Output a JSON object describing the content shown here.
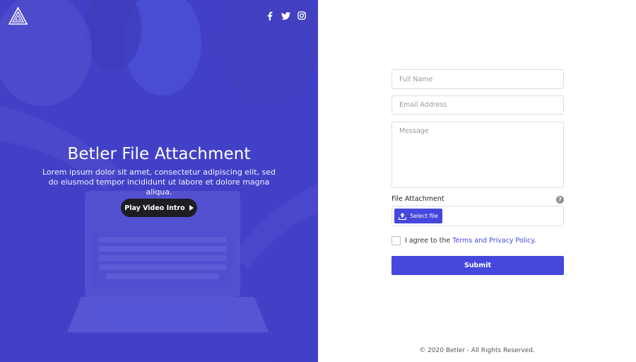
{
  "hero": {
    "title": "Betler File Attachment",
    "description": "Lorem ipsum dolor sit amet, consectetur adipiscing elit, sed do eiusmod tempor incididunt ut labore et dolore magna aliqua.",
    "video_button_label": "Play Video Intro",
    "social": [
      "facebook-icon",
      "twitter-icon",
      "instagram-icon"
    ]
  },
  "form": {
    "full_name_placeholder": "Full Name",
    "email_placeholder": "Email Address",
    "message_placeholder": "Message",
    "file_attachment_label": "File Attachment",
    "help_glyph": "?",
    "select_file_label": "Select file",
    "agree_prefix": "I agree to the ",
    "agree_link": "Terms and Privacy Policy",
    "agree_suffix": ".",
    "submit_label": "Submit"
  },
  "footer": {
    "copyright": "© 2020 Betler - All Rights Reserved."
  },
  "colors": {
    "accent": "#4547dd",
    "hero_overlay": "#4846d6",
    "video_button": "#1d1d24"
  }
}
